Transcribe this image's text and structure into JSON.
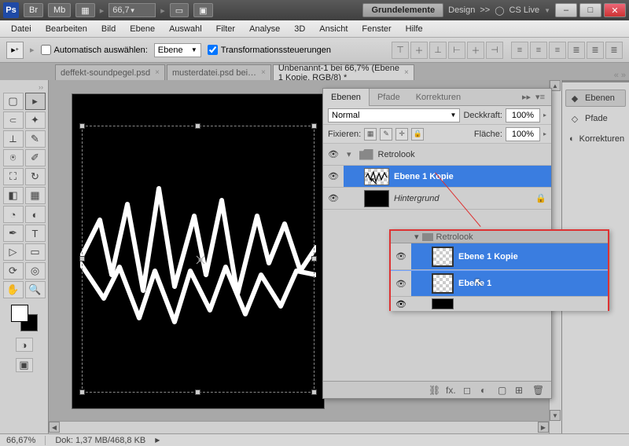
{
  "app": {
    "logo": "Ps"
  },
  "titlebar": {
    "buttons": [
      "Br",
      "Mb"
    ],
    "zoom": "66,7",
    "workspace_active": "Grundelemente",
    "workspace_other": "Design",
    "more": ">>",
    "cslive": "CS Live"
  },
  "menu": [
    "Datei",
    "Bearbeiten",
    "Bild",
    "Ebene",
    "Auswahl",
    "Filter",
    "Analyse",
    "3D",
    "Ansicht",
    "Fenster",
    "Hilfe"
  ],
  "options": {
    "auto_select_label": "Automatisch auswählen:",
    "auto_select_value": "Ebene",
    "transform_label": "Transformationssteuerungen",
    "transform_checked": true
  },
  "tabs": [
    {
      "title": "deffekt-soundpegel.psd",
      "active": false
    },
    {
      "title": "musterdatei.psd bei…",
      "active": false
    },
    {
      "title": "Unbenannt-1 bei 66,7% (Ebene 1 Kopie, RGB/8) *",
      "active": true
    }
  ],
  "right_panel": {
    "items": [
      {
        "label": "Ebenen",
        "active": true
      },
      {
        "label": "Pfade",
        "active": false
      },
      {
        "label": "Korrekturen",
        "active": false
      }
    ]
  },
  "layers_panel": {
    "tabs": [
      "Ebenen",
      "Pfade",
      "Korrekturen"
    ],
    "blend_mode": "Normal",
    "opacity_label": "Deckkraft:",
    "opacity": "100%",
    "lock_label": "Fixieren:",
    "fill_label": "Fläche:",
    "fill": "100%",
    "group": "Retrolook",
    "layer_selected": "Ebene 1 Kopie",
    "layer_bg": "Hintergrund"
  },
  "callout": {
    "header": "Retrolook",
    "row1": "Ebene 1 Kopie",
    "row2": "Ebene 1"
  },
  "statusbar": {
    "zoom": "66,67%",
    "doc": "Dok: 1,37 MB/468,8 KB"
  }
}
